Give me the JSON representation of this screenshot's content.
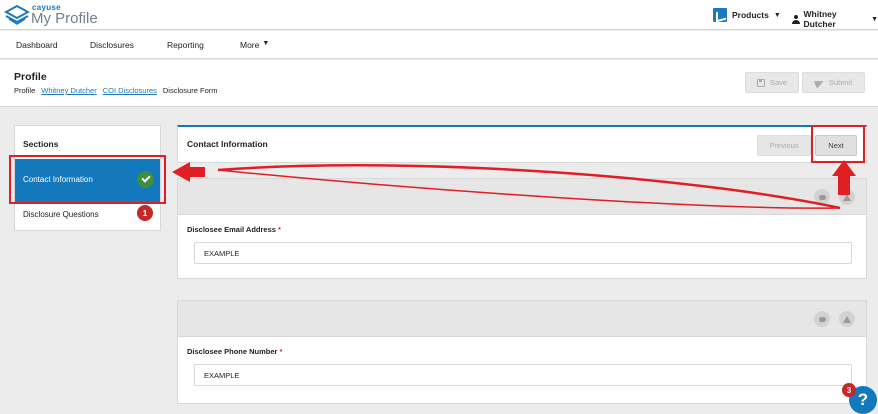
{
  "app": {
    "brand_small": "cayuse",
    "brand_title": "My Profile"
  },
  "topbar": {
    "products_label": "Products",
    "user_name": "Whitney Dutcher"
  },
  "nav": {
    "items": [
      "Dashboard",
      "Disclosures",
      "Reporting",
      "More"
    ]
  },
  "header": {
    "title": "Profile",
    "breadcrumbs": {
      "root": "Profile",
      "person": "Whitney Dutcher",
      "coi": "COI Disclosures",
      "current": "Disclosure Form"
    },
    "save_label": "Save",
    "submit_label": "Submit"
  },
  "sections": {
    "title": "Sections",
    "items": [
      {
        "label": "Contact Information",
        "active": true,
        "complete": true
      },
      {
        "label": "Disclosure Questions",
        "active": false,
        "badge": "1"
      }
    ]
  },
  "main": {
    "title": "Contact Information",
    "previous_label": "Previous",
    "next_label": "Next",
    "fields": [
      {
        "label": "Disclosee Email Address",
        "required": "*",
        "value": "EXAMPLE"
      },
      {
        "label": "Disclosee Phone Number",
        "required": "*",
        "value": "EXAMPLE"
      }
    ]
  },
  "help": {
    "icon_text": "?",
    "badge": "3"
  },
  "colors": {
    "accent": "#1478bd",
    "success": "#3d8f3d",
    "alert": "#c62828",
    "annotation": "#e01e24"
  },
  "icons": [
    "cayuse-logo-icon",
    "products-icon",
    "user-icon",
    "save-icon",
    "submit-icon",
    "check-icon",
    "comment-icon",
    "warning-icon",
    "help-icon"
  ]
}
